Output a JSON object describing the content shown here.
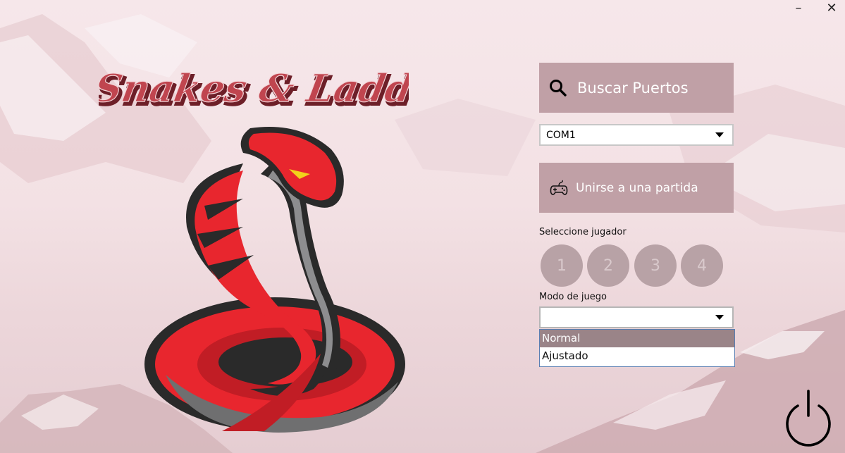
{
  "window": {
    "minimize_glyph": "–",
    "close_glyph": "✕"
  },
  "logo": {
    "title_text": "Snakes & Ladders",
    "icon": "cobra-mascot"
  },
  "search_button": {
    "label": "Buscar Puertos",
    "icon": "search-icon"
  },
  "port_select": {
    "value": "COM1"
  },
  "join_button": {
    "label": "Unirse a una partida",
    "icon": "gamepad-icon"
  },
  "player_select": {
    "label": "Seleccione jugador",
    "players": [
      "1",
      "2",
      "3",
      "4"
    ]
  },
  "mode_select": {
    "label": "Modo de juego",
    "value": "",
    "options": [
      "Normal",
      "Ajustado"
    ],
    "highlighted_index": 0
  },
  "power": {
    "icon": "power-icon"
  },
  "colors": {
    "button_bg": "#c0a0a6",
    "player_bg": "#b8a2a6",
    "highlight": "#9a8488",
    "snake_red": "#e8262e",
    "logo_red": "#b84049"
  }
}
